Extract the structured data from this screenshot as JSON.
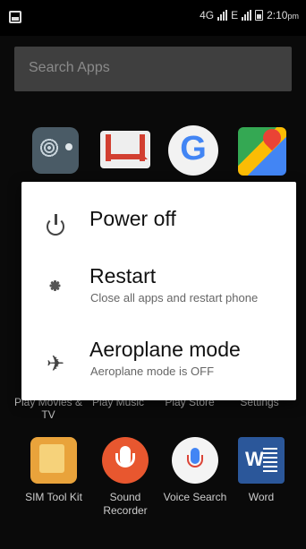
{
  "status_bar": {
    "network": "4G",
    "network2": "E",
    "time": "2:10",
    "ampm": "pm"
  },
  "search": {
    "placeholder": "Search Apps"
  },
  "power_menu": {
    "options": [
      {
        "title": "Power off",
        "subtitle": ""
      },
      {
        "title": "Restart",
        "subtitle": "Close all apps and restart phone"
      },
      {
        "title": "Aeroplane mode",
        "subtitle": "Aeroplane mode is OFF"
      }
    ]
  },
  "hidden_row_labels": [
    "Play Movies & TV",
    "Play Music",
    "Play Store",
    "Settings"
  ],
  "bottom_apps": [
    {
      "name": "SIM Tool Kit",
      "icon": "sim-toolkit-icon"
    },
    {
      "name": "Sound Recorder",
      "icon": "microphone-icon"
    },
    {
      "name": "Voice Search",
      "icon": "voice-search-icon"
    },
    {
      "name": "Word",
      "icon": "word-icon"
    }
  ],
  "top_apps": [
    {
      "icon": "radio-icon"
    },
    {
      "icon": "gmail-icon"
    },
    {
      "icon": "google-icon"
    },
    {
      "icon": "maps-icon"
    }
  ]
}
